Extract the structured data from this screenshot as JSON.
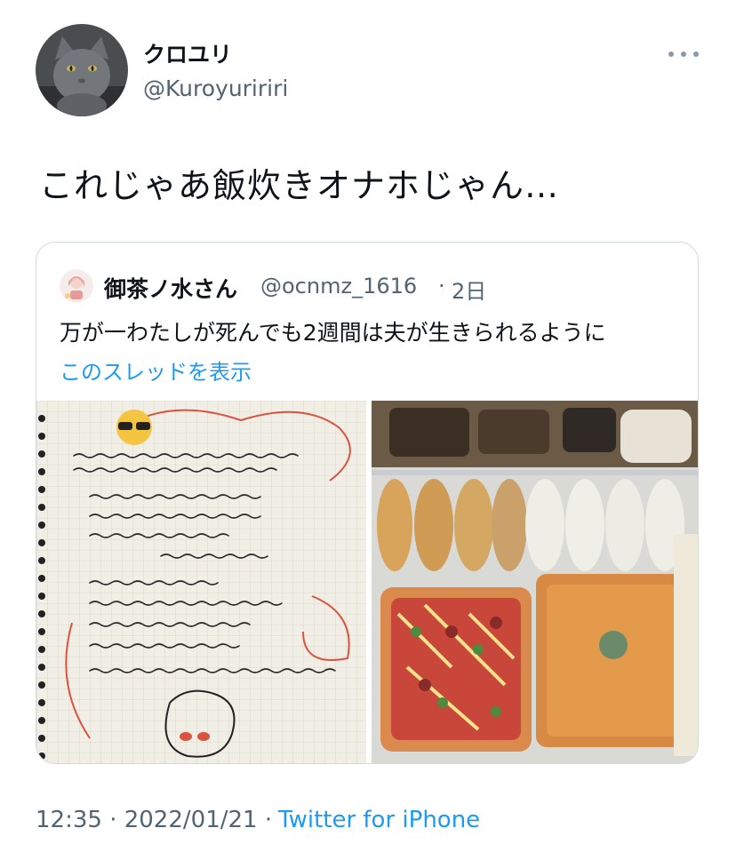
{
  "tweet": {
    "display_name": "クロユリ",
    "handle": "@Kuroyuririri",
    "text": "これじゃあ飯炊きオナホじゃん…",
    "timestamp": "12:35 · 2022/01/21 ·",
    "source": "Twitter for iPhone"
  },
  "quoted_tweet": {
    "display_name": "御茶ノ水さん",
    "handle": "@ocnmz_1616",
    "separator": "·",
    "time": "2日",
    "text": "万が一わたしが死んでも2週間は夫が生きられるように",
    "show_thread": "このスレッドを表示"
  },
  "icons": {
    "avatar": "gray-cat-avatar",
    "more": "more-options-icon",
    "quoted_avatar": "illustrated-avatar"
  },
  "colors": {
    "link": "#1d9bf0",
    "secondary_text": "#536471",
    "border": "#cfd9de"
  }
}
